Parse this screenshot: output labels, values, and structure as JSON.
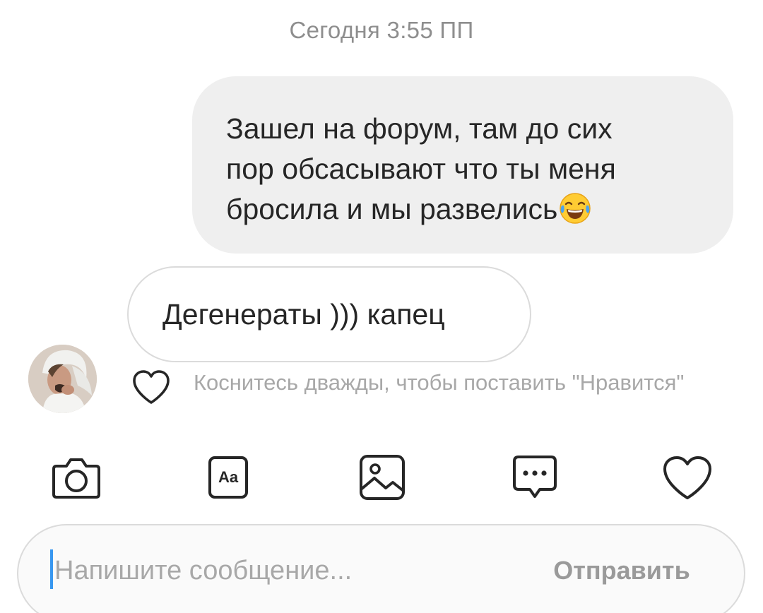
{
  "header": {
    "timestamp": "Сегодня 3:55 ПП"
  },
  "messages": {
    "outgoing": {
      "text": "Зашел на форум, там до сих\nпор обсасывают что ты меня\nбросила и мы развелись",
      "emoji": "face-with-tears-of-joy"
    },
    "incoming": {
      "text": "Дегенераты ))) капец"
    }
  },
  "reaction_hint": {
    "text": "Коснитесь дважды, чтобы поставить \"Нравится\""
  },
  "toolbar": {
    "icons": [
      "camera-icon",
      "text-style-icon",
      "gallery-icon",
      "more-icon",
      "heart-icon"
    ],
    "text_style_label": "Aa"
  },
  "composer": {
    "placeholder": "Напишите сообщение...",
    "value": "",
    "send_label": "Отправить"
  },
  "colors": {
    "outgoing_bubble": "#efefef",
    "text": "#262626",
    "muted_text": "#8e8e8e",
    "border": "#dbdbdb",
    "caret": "#3897f0"
  }
}
